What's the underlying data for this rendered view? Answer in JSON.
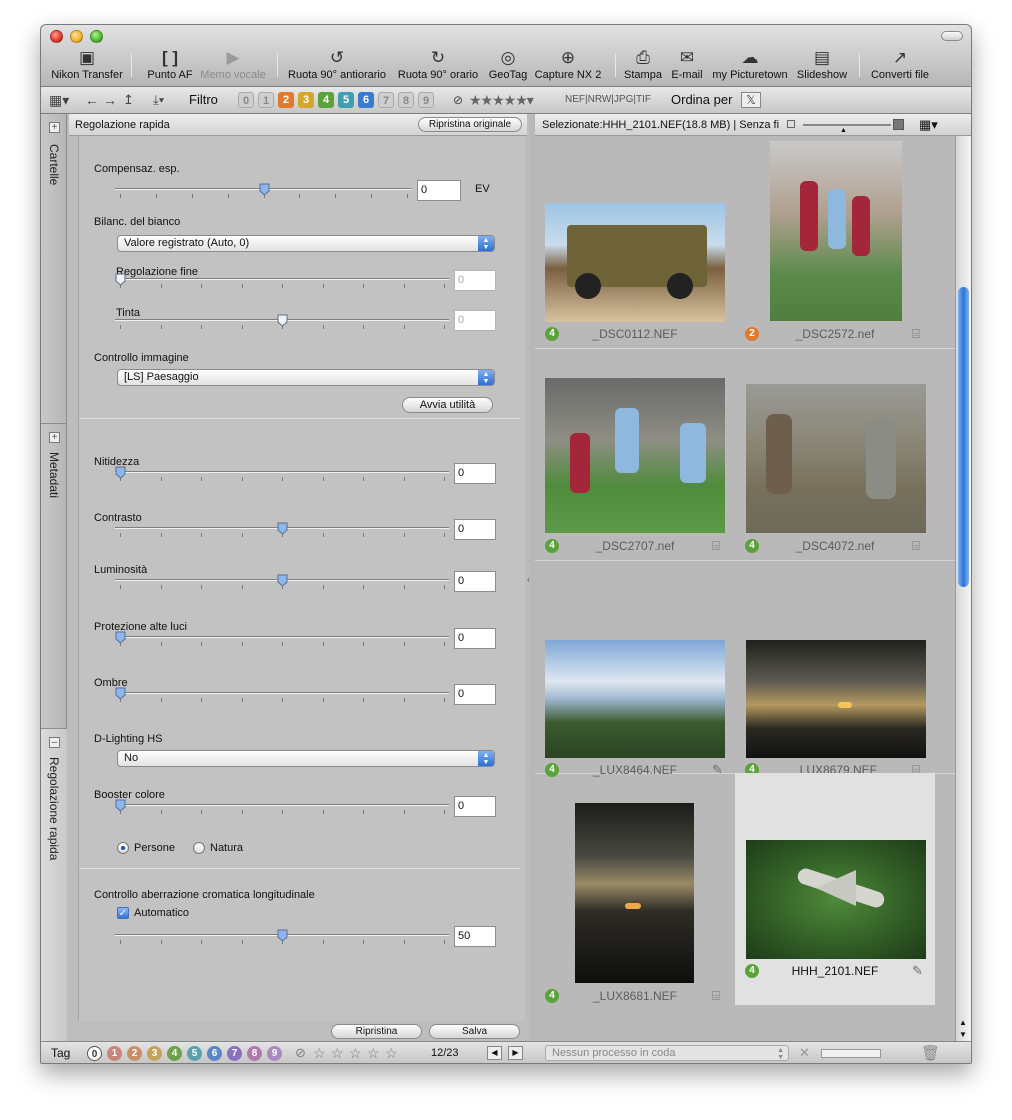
{
  "toolbar": {
    "items": [
      {
        "label": "Nikon Transfer",
        "icon": "camera-transfer-icon"
      },
      {
        "label": "Punto AF",
        "icon": "af-point-icon"
      },
      {
        "label": "Memo vocale",
        "icon": "voice-memo-icon",
        "disabled": true
      },
      {
        "label": "Ruota 90° antiorario",
        "icon": "rotate-ccw-icon"
      },
      {
        "label": "Ruota 90° orario",
        "icon": "rotate-cw-icon"
      },
      {
        "label": "GeoTag",
        "icon": "globe-icon"
      },
      {
        "label": "Capture NX 2",
        "icon": "capture-nx-icon"
      },
      {
        "label": "Stampa",
        "icon": "printer-icon"
      },
      {
        "label": "E-mail",
        "icon": "envelope-icon"
      },
      {
        "label": "my Picturetown",
        "icon": "picturetown-icon"
      },
      {
        "label": "Slideshow",
        "icon": "slideshow-icon"
      },
      {
        "label": "Converti file",
        "icon": "convert-file-icon"
      }
    ]
  },
  "filterbar": {
    "filter_label": "Filtro",
    "label_numbers": [
      "0",
      "1",
      "2",
      "3",
      "4",
      "5",
      "6",
      "7",
      "8",
      "9"
    ],
    "file_types": "NEF|NRW|JPG|TIF",
    "sort_label": "Ordina per"
  },
  "side_tabs": {
    "folders": "Cartelle",
    "metadata": "Metadati",
    "quick_adjust": "Regolazione rapida"
  },
  "panel": {
    "title": "Regolazione rapida",
    "reset_original": "Ripristina originale",
    "exposure_label": "Compensaz. esp.",
    "exposure_value": "0",
    "exposure_unit": "EV",
    "wb_label": "Bilanc. del bianco",
    "wb_value": "Valore registrato (Auto, 0)",
    "fine_label": "Regolazione fine",
    "fine_value": "0",
    "tint_label": "Tinta",
    "tint_value": "0",
    "picture_control_label": "Controllo immagine",
    "picture_control_value": "[LS] Paesaggio",
    "launch_utility": "Avvia utilità",
    "sharpness_label": "Nitidezza",
    "sharpness_value": "0",
    "contrast_label": "Contrasto",
    "contrast_value": "0",
    "brightness_label": "Luminosità",
    "brightness_value": "0",
    "highlight_label": "Protezione alte luci",
    "highlight_value": "0",
    "shadow_label": "Ombre",
    "shadow_value": "0",
    "dlighting_label": "D-Lighting HS",
    "dlighting_value": "No",
    "booster_label": "Booster colore",
    "booster_value": "0",
    "radio_people": "Persone",
    "radio_nature": "Natura",
    "aberration_label": "Controllo aberrazione cromatica longitudinale",
    "auto_label": "Automatico",
    "aberration_value": "50",
    "reset_button": "Ripristina",
    "save_button": "Salva"
  },
  "browser": {
    "header": "Selezionate:HHH_2101.NEF(18.8 MB) | Senza fi",
    "thumbnails": [
      {
        "name": "_DSC0112.NEF",
        "label": "4"
      },
      {
        "name": "_DSC2572.nef",
        "label": "2"
      },
      {
        "name": "_DSC2707.nef",
        "label": "4"
      },
      {
        "name": "_DSC4072.nef",
        "label": "4"
      },
      {
        "name": "_LUX8464.NEF",
        "label": "4"
      },
      {
        "name": "_LUX8679.NEF",
        "label": "4"
      },
      {
        "name": "_LUX8681.NEF",
        "label": "4"
      },
      {
        "name": "HHH_2101.NEF",
        "label": "4"
      }
    ]
  },
  "statusbar": {
    "tag_label": "Tag",
    "tags": [
      "0",
      "1",
      "2",
      "3",
      "4",
      "5",
      "6",
      "7",
      "8",
      "9"
    ],
    "counter": "12/23",
    "queue": "Nessun processo in coda"
  },
  "colors": {
    "label_orange": "#e07a2c",
    "label_green": "#5aa33a",
    "accent_blue": "#2e73d8"
  }
}
